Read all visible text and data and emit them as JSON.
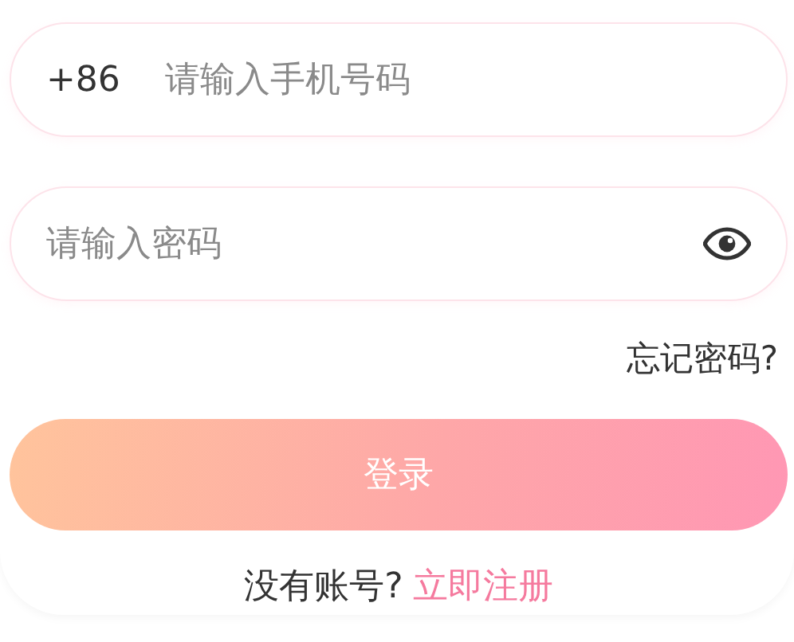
{
  "phone_field": {
    "country_code": "+86",
    "placeholder": "请输入手机号码"
  },
  "password_field": {
    "placeholder": "请输入密码"
  },
  "forgot_password": "忘记密码?",
  "login_button": "登录",
  "register_prompt": {
    "text": "没有账号?",
    "link": "立即注册"
  }
}
